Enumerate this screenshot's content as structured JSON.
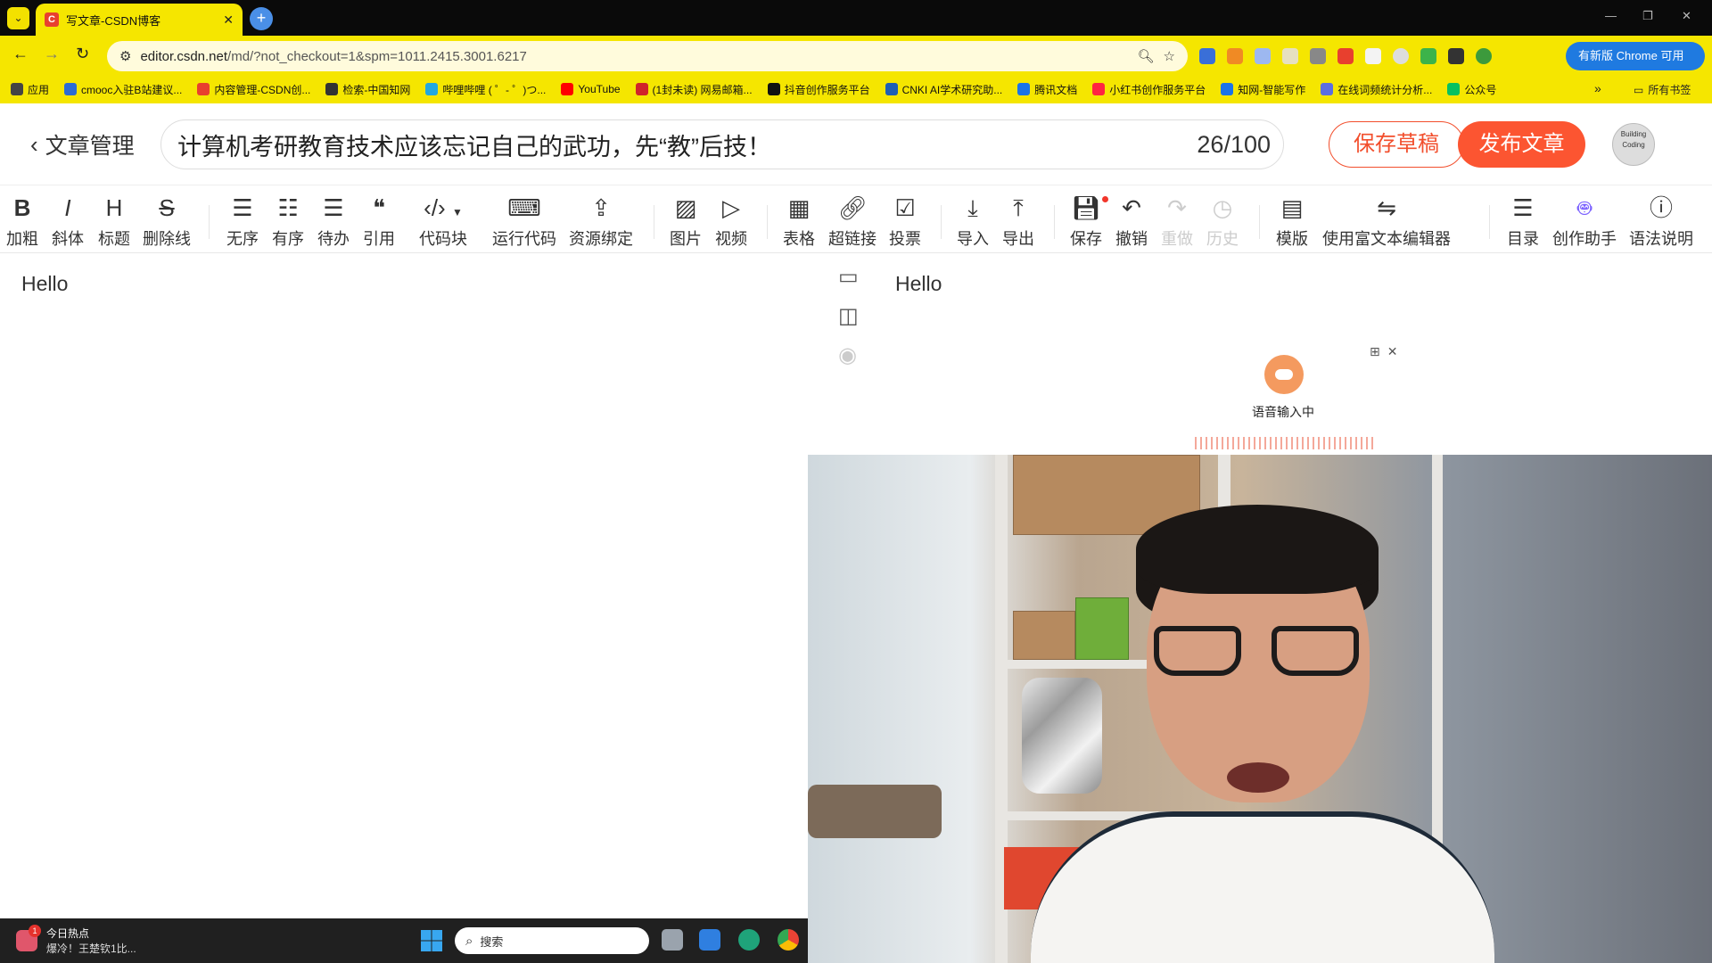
{
  "browser": {
    "tab_title": "写文章-CSDN博客",
    "favicon_letter": "C",
    "url_host": "editor.csdn.net",
    "url_path": "/md/?not_checkout=1&spm=1011.2415.3001.6217",
    "update_label": "有新版 Chrome 可用",
    "bookmarks": [
      {
        "label": "应用",
        "color": "#555555"
      },
      {
        "label": "cmooc入驻B站建议...",
        "color": "#2b6cd4"
      },
      {
        "label": "内容管理-CSDN创...",
        "color": "#e8402e"
      },
      {
        "label": "检索-中国知网",
        "color": "#333333"
      },
      {
        "label": "哔哩哔哩 ( ゜- ゜)つ...",
        "color": "#22a8e0"
      },
      {
        "label": "YouTube",
        "color": "#ff0000"
      },
      {
        "label": "(1封未读) 网易邮箱...",
        "color": "#d0242a"
      },
      {
        "label": "抖音创作服务平台",
        "color": "#111111"
      },
      {
        "label": "CNKI AI学术研究助...",
        "color": "#1e5fb4"
      },
      {
        "label": "腾讯文档",
        "color": "#1a73e8"
      },
      {
        "label": "小红书创作服务平台",
        "color": "#ff2442"
      },
      {
        "label": "知网-智能写作",
        "color": "#1a73e8"
      },
      {
        "label": "在线词频统计分析...",
        "color": "#5b6ee1"
      },
      {
        "label": "公众号",
        "color": "#07c160"
      }
    ],
    "all_bookmarks_label": "所有书签"
  },
  "editor": {
    "back_label": "文章管理",
    "title": "计算机考研教育技术应该忘记自己的武功，先“教”后技！",
    "title_count": "26/100",
    "save_draft_label": "保存草稿",
    "publish_label": "发布文章",
    "avatar_text": "Building Coding",
    "content": "Hello",
    "preview_content": "Hello"
  },
  "toolbar": {
    "bold": "加粗",
    "italic": "斜体",
    "heading": "标题",
    "strike": "删除线",
    "ul": "无序",
    "ol": "有序",
    "todo": "待办",
    "quote": "引用",
    "code": "代码块",
    "run": "运行代码",
    "resource": "资源绑定",
    "image": "图片",
    "video": "视频",
    "table": "表格",
    "link": "超链接",
    "vote": "投票",
    "import": "导入",
    "export": "导出",
    "save": "保存",
    "undo": "撤销",
    "redo": "重做",
    "history": "历史",
    "template": "模版",
    "richtext": "使用富文本编辑器",
    "toc": "目录",
    "assistant": "创作助手",
    "syntax": "语法说明"
  },
  "voice": {
    "label": "语音输入中"
  },
  "taskbar": {
    "news_title": "今日热点",
    "news_text": "爆冷！王楚钦1比...",
    "news_badge": "1",
    "search_placeholder": "搜索"
  }
}
